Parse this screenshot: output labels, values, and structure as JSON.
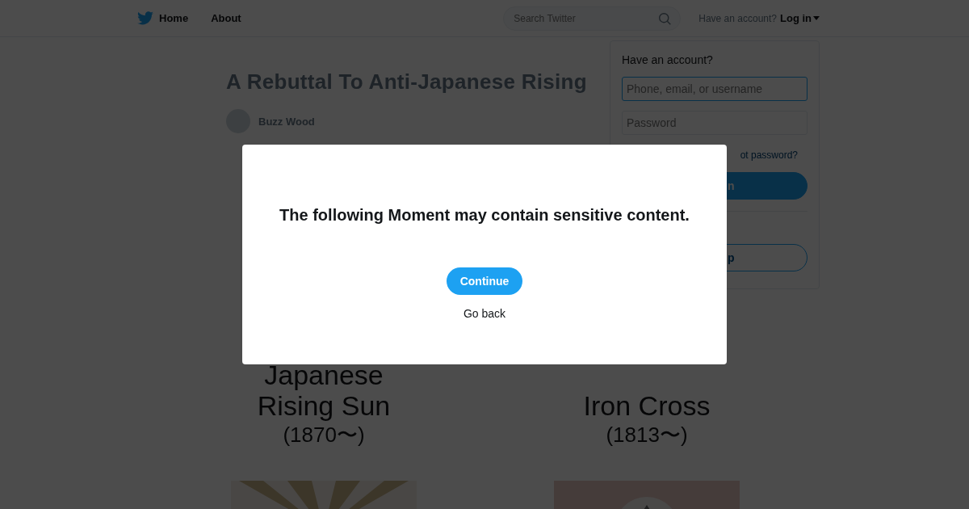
{
  "nav": {
    "items": [
      {
        "label": "Home"
      },
      {
        "label": "About"
      }
    ],
    "search": {
      "placeholder": "Search Twitter"
    },
    "account_prompt": "Have an account?",
    "login": "Log in"
  },
  "moment": {
    "title": "A Rebuttal To Anti-Japanese Rising",
    "author": "Buzz Wood",
    "cards": [
      {
        "lines": [
          "Japanese",
          "Rising Sun",
          "(1870〜)"
        ]
      },
      {
        "lines": [
          "Iron Cross",
          "(1813〜)"
        ]
      }
    ]
  },
  "login_dropdown": {
    "heading": "Have an account?",
    "username": {
      "placeholder": "Phone, email, or username"
    },
    "password": {
      "placeholder": "Password"
    },
    "forgot": "ot password?",
    "login_button": "n",
    "signup_button": "p"
  },
  "dialog": {
    "message": "The following Moment may contain sensitive content.",
    "continue": "Continue",
    "go_back": "Go back"
  }
}
